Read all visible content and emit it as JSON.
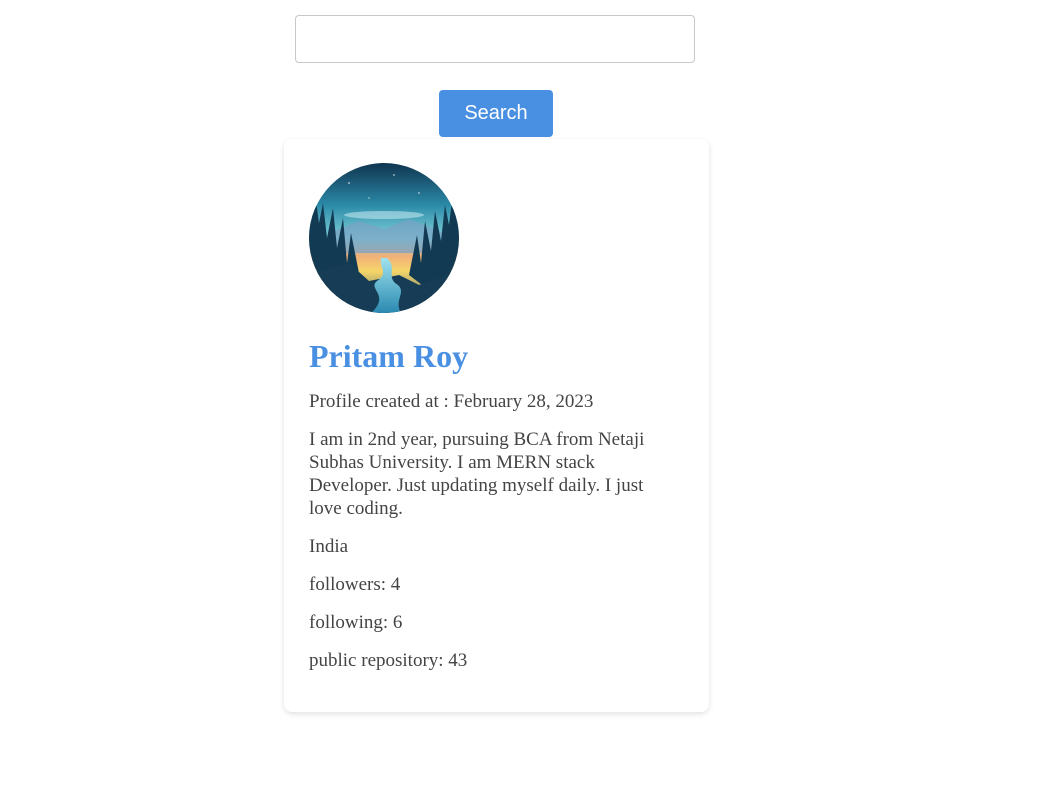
{
  "search": {
    "placeholder": "",
    "value": "",
    "button_label": "Search"
  },
  "profile": {
    "name": "Pritam Roy",
    "created_label": "Profile created at : February 28, 2023",
    "bio": "I am in 2nd year, pursuing BCA from Netaji Subhas University. I am MERN stack Developer. Just updating myself daily. I just love coding.",
    "location": "India",
    "followers_label": "followers: 4",
    "following_label": "following: 6",
    "repos_label": "public repository: 43"
  },
  "colors": {
    "accent": "#4a90e2",
    "text": "#444444",
    "border": "#c8c8c8"
  }
}
